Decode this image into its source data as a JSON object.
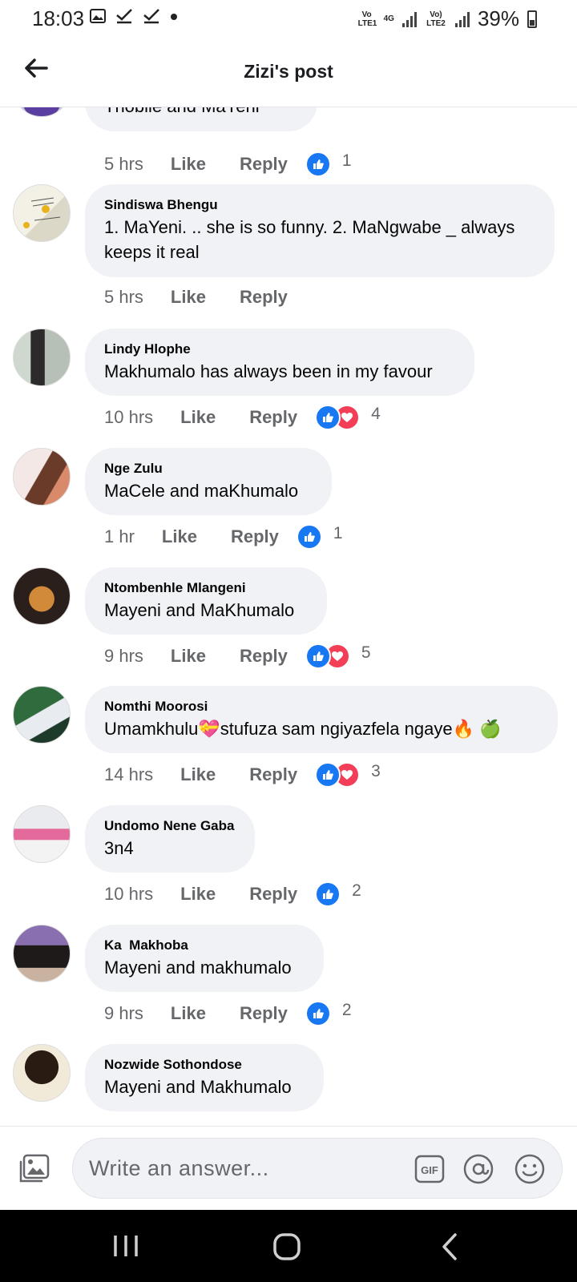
{
  "status_bar": {
    "time": "18:03",
    "icons": [
      "gallery-icon",
      "check-icon",
      "check-icon",
      "dot-icon"
    ],
    "sim1": "Vo LTE1",
    "network": "4G",
    "sim2": "Vo) LTE2",
    "battery": "39%"
  },
  "header": {
    "title": "Zizi's post",
    "back_icon": "arrow-left-icon"
  },
  "comments": [
    {
      "name": "",
      "text": "Thobile and MaYeni",
      "time": "5 hrs",
      "like_label": "Like",
      "reply_label": "Reply",
      "reactions": [
        "like"
      ],
      "reaction_count": "1"
    },
    {
      "name": "Sindiswa Bhengu",
      "text": "1. MaYeni. .. she is so funny. 2. MaNgwabe _ always keeps it real",
      "time": "5 hrs",
      "like_label": "Like",
      "reply_label": "Reply",
      "reactions": [],
      "reaction_count": ""
    },
    {
      "name": "Lindy Hlophe",
      "text": "Makhumalo has always been in my favour",
      "time": "10 hrs",
      "like_label": "Like",
      "reply_label": "Reply",
      "reactions": [
        "like",
        "love"
      ],
      "reaction_count": "4"
    },
    {
      "name": "Nge Zulu",
      "text": "MaCele and maKhumalo",
      "time": "1 hr",
      "like_label": "Like",
      "reply_label": "Reply",
      "reactions": [
        "like"
      ],
      "reaction_count": "1"
    },
    {
      "name": "Ntombenhle Mlangeni",
      "text": "Mayeni and MaKhumalo",
      "time": "9 hrs",
      "like_label": "Like",
      "reply_label": "Reply",
      "reactions": [
        "like",
        "love"
      ],
      "reaction_count": "5"
    },
    {
      "name": "Nomthi Moorosi",
      "text": "Umamkhulu💝stufuza sam ngiyazfela ngaye🔥 🍏",
      "time": "14 hrs",
      "like_label": "Like",
      "reply_label": "Reply",
      "reactions": [
        "like",
        "love"
      ],
      "reaction_count": "3"
    },
    {
      "name": "Undomo Nene Gaba",
      "text": "3n4",
      "time": "10 hrs",
      "like_label": "Like",
      "reply_label": "Reply",
      "reactions": [
        "like"
      ],
      "reaction_count": "2"
    },
    {
      "name": "Ka  Makhoba",
      "text": "Mayeni and makhumalo",
      "time": "9 hrs",
      "like_label": "Like",
      "reply_label": "Reply",
      "reactions": [
        "like"
      ],
      "reaction_count": "2"
    },
    {
      "name": "Nozwide Sothondose",
      "text": "Mayeni and Makhumalo",
      "time": "",
      "like_label": "",
      "reply_label": "",
      "reactions": [],
      "reaction_count": ""
    }
  ],
  "composer": {
    "placeholder": "Write an answer...",
    "icons": [
      "photo-icon",
      "gif-icon",
      "at-mention-icon",
      "emoji-icon"
    ]
  },
  "colors": {
    "bubble": "#f0f2f5",
    "like_blue": "#1877f2",
    "love_red": "#f33e58",
    "meta_gray": "#65676b"
  },
  "nav_icons": [
    "recent-apps-icon",
    "home-icon",
    "back-icon"
  ]
}
